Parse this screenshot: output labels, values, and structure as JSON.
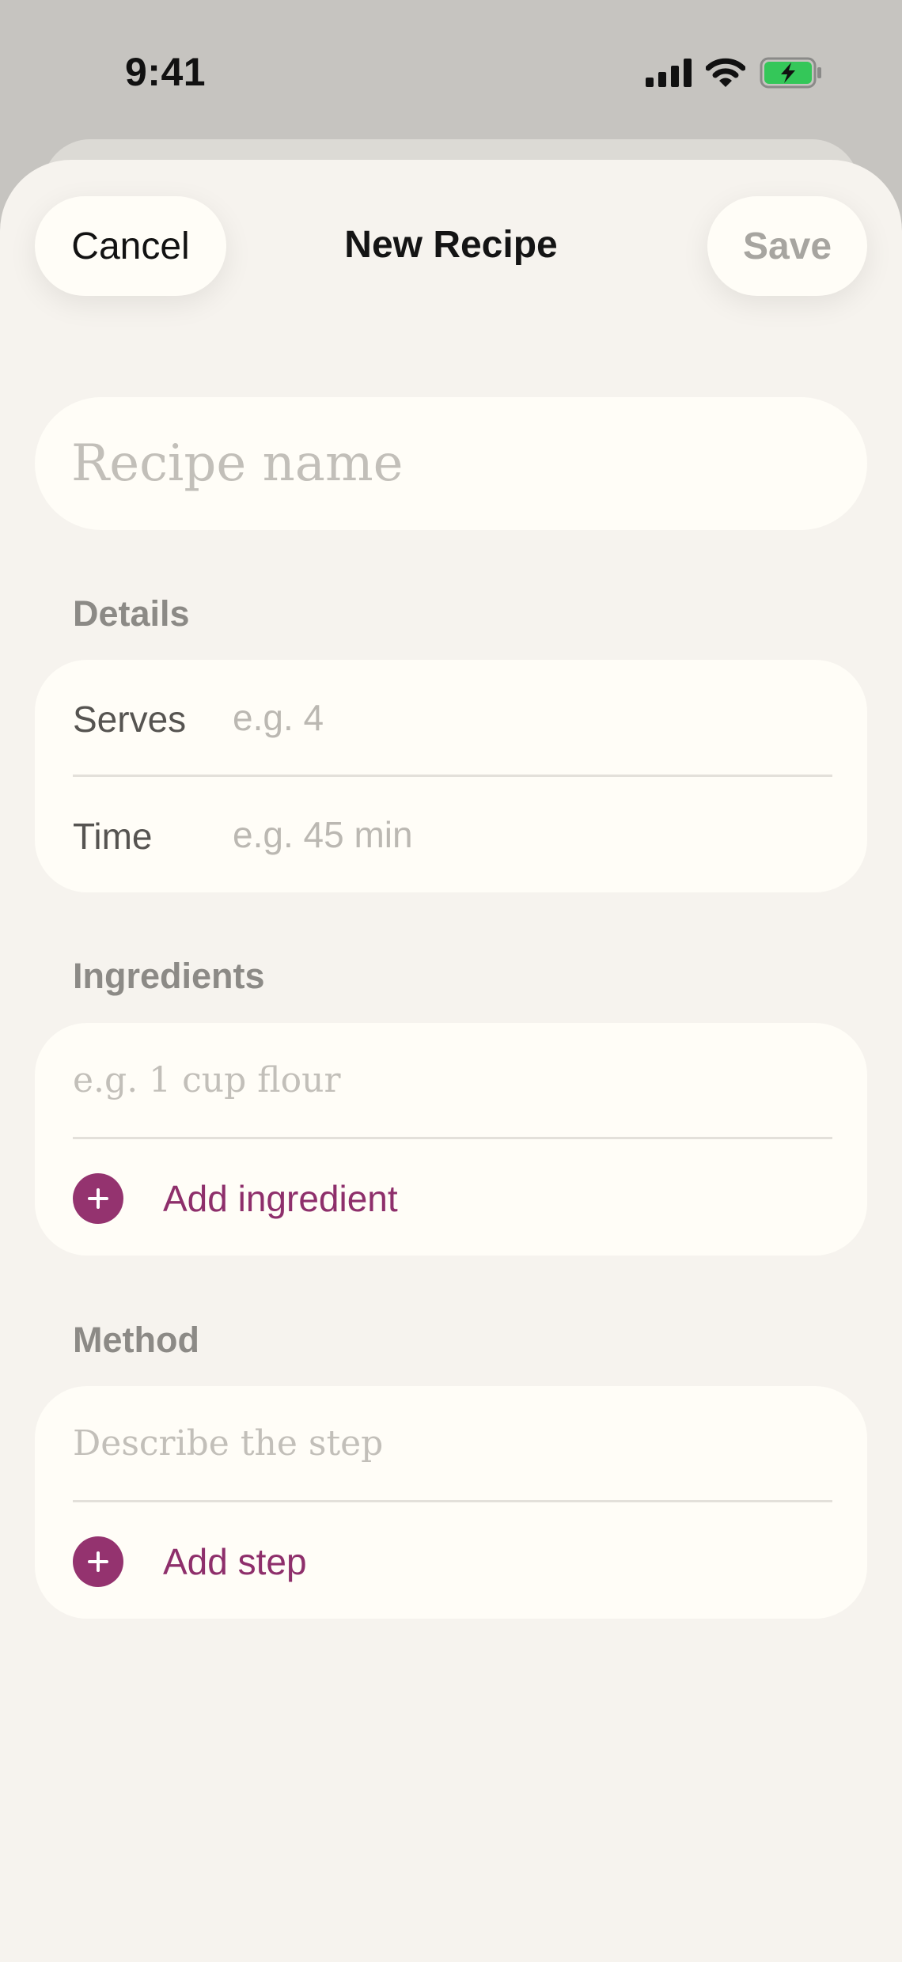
{
  "status_bar": {
    "time": "9:41",
    "icons": [
      "cellular-signal-icon",
      "wifi-icon",
      "battery-charging-icon"
    ],
    "battery_color": "#34c759"
  },
  "nav": {
    "cancel_label": "Cancel",
    "title": "New Recipe",
    "save_label": "Save"
  },
  "recipe_name": {
    "value": "",
    "placeholder": "Recipe name"
  },
  "details": {
    "heading": "Details",
    "rows": [
      {
        "label": "Serves",
        "value": "",
        "placeholder": "e.g. 4"
      },
      {
        "label": "Time",
        "value": "",
        "placeholder": "e.g. 45 min"
      }
    ]
  },
  "ingredients": {
    "heading": "Ingredients",
    "item_placeholder": "e.g. 1 cup flour",
    "add_label": "Add ingredient"
  },
  "method": {
    "heading": "Method",
    "step_placeholder": "Describe the step",
    "add_label": "Add step"
  },
  "colors": {
    "accent": "#94336f",
    "sheet_background": "#f6f3ee",
    "card_background": "#fffdf7",
    "backdrop": "#c6c4c0"
  }
}
